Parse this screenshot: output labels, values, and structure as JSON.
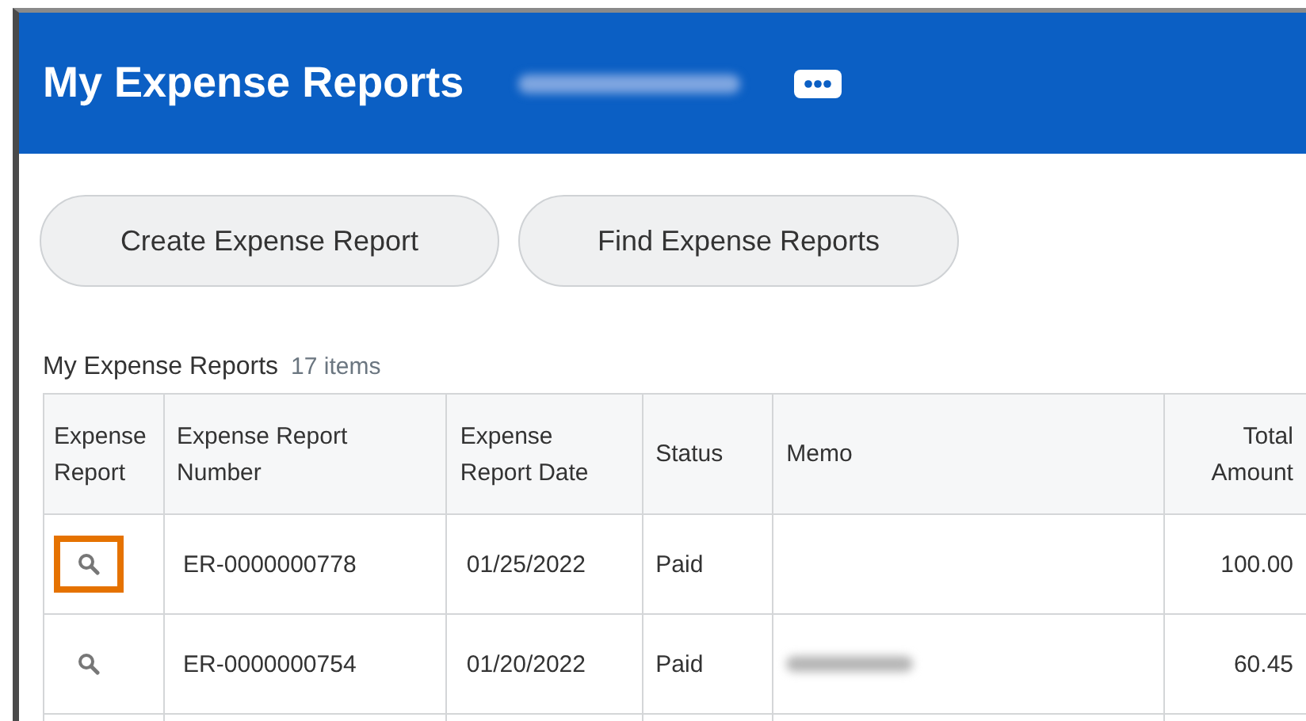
{
  "header": {
    "title": "My Expense Reports",
    "user_name_redacted": true
  },
  "buttons": [
    "Create Expense Report",
    "Find Expense Reports"
  ],
  "table": {
    "title": "My Expense Reports",
    "count": "17 items",
    "columns": [
      "Expense Report",
      "Expense Report Number",
      "Expense Report Date",
      "Status",
      "Memo",
      "Total Amount"
    ],
    "rows": [
      {
        "highlighted": true,
        "number": "ER-0000000778",
        "date": "01/25/2022",
        "status": "Paid",
        "memo_redacted": false,
        "amount": "100.00"
      },
      {
        "highlighted": false,
        "number": "ER-0000000754",
        "date": "01/20/2022",
        "status": "Paid",
        "memo_redacted": true,
        "amount": "60.45"
      }
    ]
  }
}
